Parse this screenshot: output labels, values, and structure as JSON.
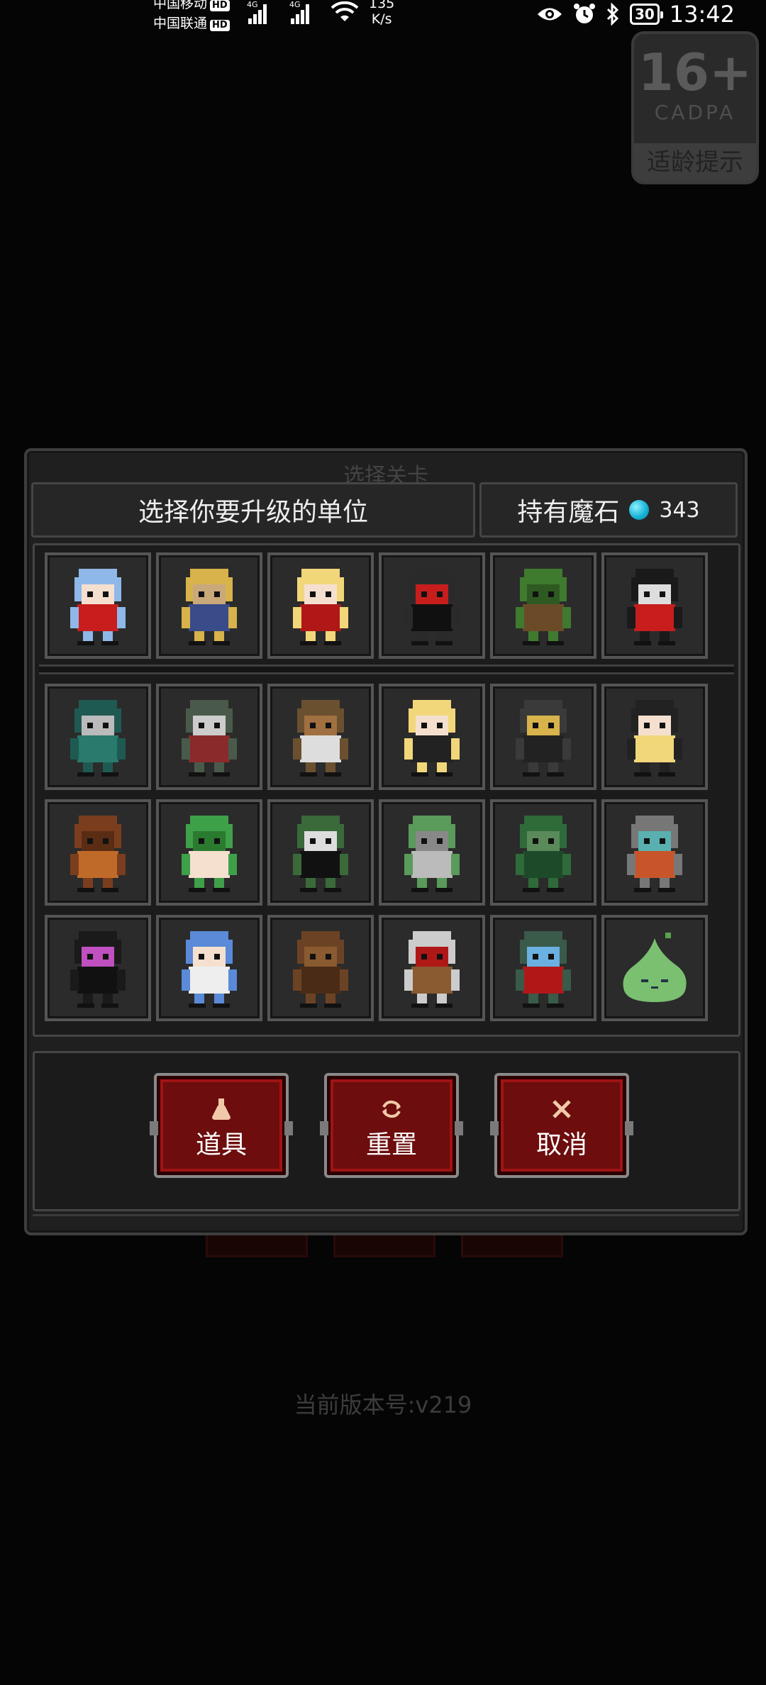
{
  "status_bar": {
    "carrier1": "中国移动",
    "carrier2": "中国联通",
    "hd": "HD",
    "network": "4G",
    "speed_value": "135",
    "speed_unit": "K/s",
    "battery": "30",
    "time": "13:42"
  },
  "age_badge": {
    "rating": "16+",
    "org": "CADPA",
    "tip": "适龄提示"
  },
  "dialog": {
    "title": "选择关卡",
    "header": "选择你要升级的单位",
    "magic_stone_label": "持有魔石",
    "magic_stone_count": "343"
  },
  "units": [
    {
      "name": "maid-princess"
    },
    {
      "name": "pharaoh"
    },
    {
      "name": "vampire-girl"
    },
    {
      "name": "grim-reaper"
    },
    {
      "name": "treant-beast"
    },
    {
      "name": "dark-lich"
    },
    {
      "name": "green-golem"
    },
    {
      "name": "orc-shaman"
    },
    {
      "name": "minotaur"
    },
    {
      "name": "blonde-succubus"
    },
    {
      "name": "bat-demon"
    },
    {
      "name": "nun"
    },
    {
      "name": "rock-golem"
    },
    {
      "name": "medusa"
    },
    {
      "name": "frankenstein"
    },
    {
      "name": "spiked-turtle"
    },
    {
      "name": "dragon-serpent"
    },
    {
      "name": "robot"
    },
    {
      "name": "dark-mage"
    },
    {
      "name": "elf-knight"
    },
    {
      "name": "tree-ent"
    },
    {
      "name": "skeleton-knight"
    },
    {
      "name": "zombie-guard"
    },
    {
      "name": "green-slime"
    }
  ],
  "actions": {
    "items": "道具",
    "reset": "重置",
    "cancel": "取消"
  },
  "version": "当前版本号:v219"
}
